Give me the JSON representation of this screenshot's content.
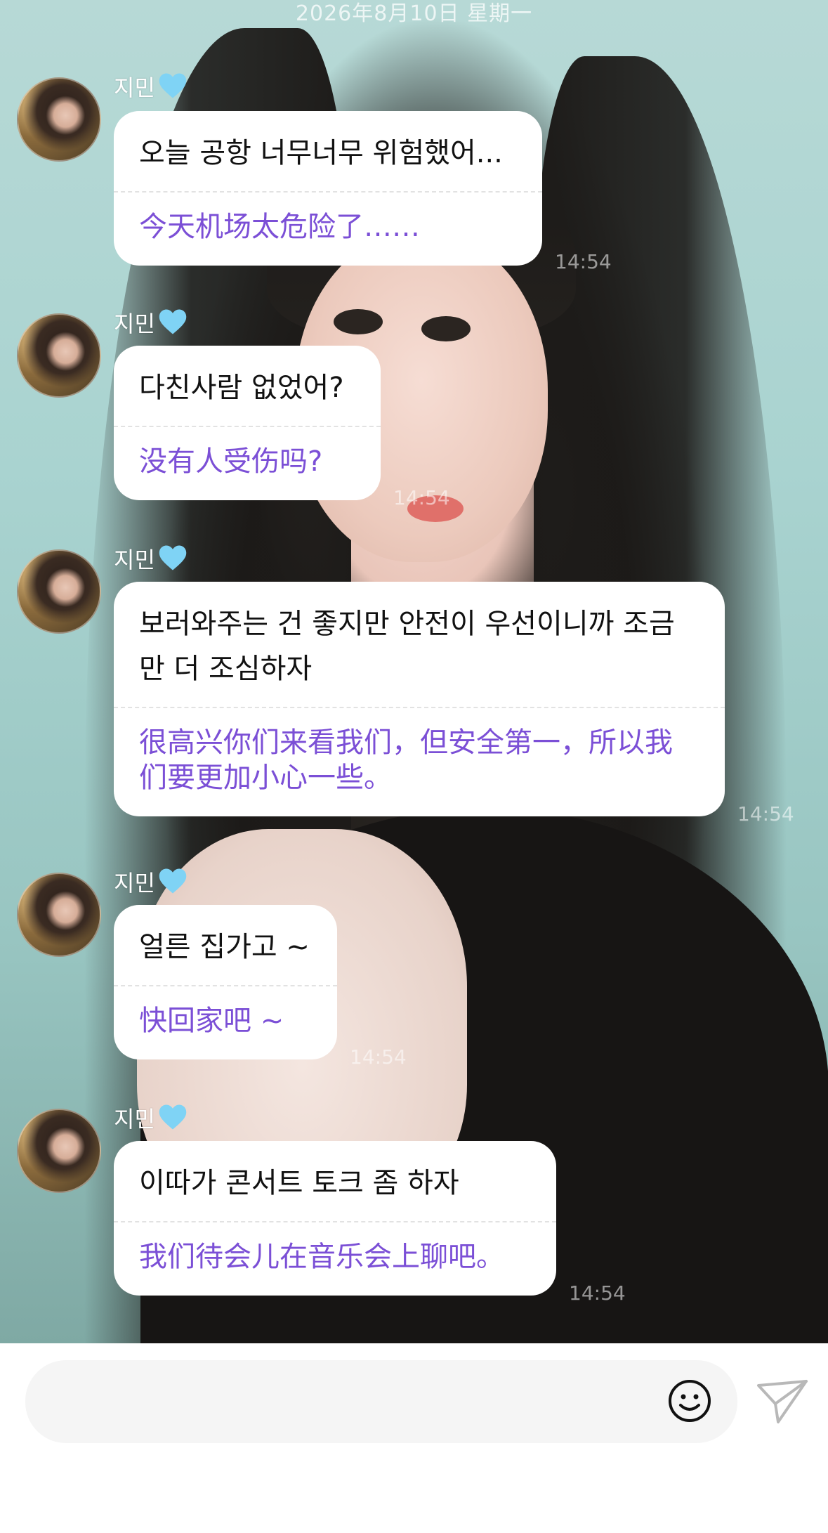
{
  "header": {
    "date": "2026年8月10日 星期一"
  },
  "messages": [
    {
      "sender": "지민",
      "sender_icon": "light-blue-heart-icon",
      "korean": "오늘 공항 너무너무 위험했어...",
      "chinese": "今天机场太危险了……",
      "time": "14:54"
    },
    {
      "sender": "지민",
      "sender_icon": "light-blue-heart-icon",
      "korean": "다친사람 없었어?",
      "chinese": "没有人受伤吗?",
      "time": "14:54"
    },
    {
      "sender": "지민",
      "sender_icon": "light-blue-heart-icon",
      "korean": "보러와주는 건 좋지만 안전이 우선이니까 조금만 더 조심하자",
      "chinese": "很高兴你们来看我们，但安全第一，所以我们要更加小心一些。",
      "time": "14:54"
    },
    {
      "sender": "지민",
      "sender_icon": "light-blue-heart-icon",
      "korean": "얼른 집가고 ~",
      "chinese": "快回家吧 ~",
      "time": "14:54"
    },
    {
      "sender": "지민",
      "sender_icon": "light-blue-heart-icon",
      "korean": "이따가 콘서트 토크 좀 하자",
      "chinese": "我们待会儿在音乐会上聊吧。",
      "time": "14:54"
    }
  ],
  "composer": {
    "placeholder": "",
    "emoji_icon": "smiley-face-icon",
    "send_icon": "paper-plane-send-icon"
  },
  "colors": {
    "translation_text": "#7b4fd6",
    "bubble_bg": "#ffffff",
    "heart": "#7fd3f5"
  }
}
